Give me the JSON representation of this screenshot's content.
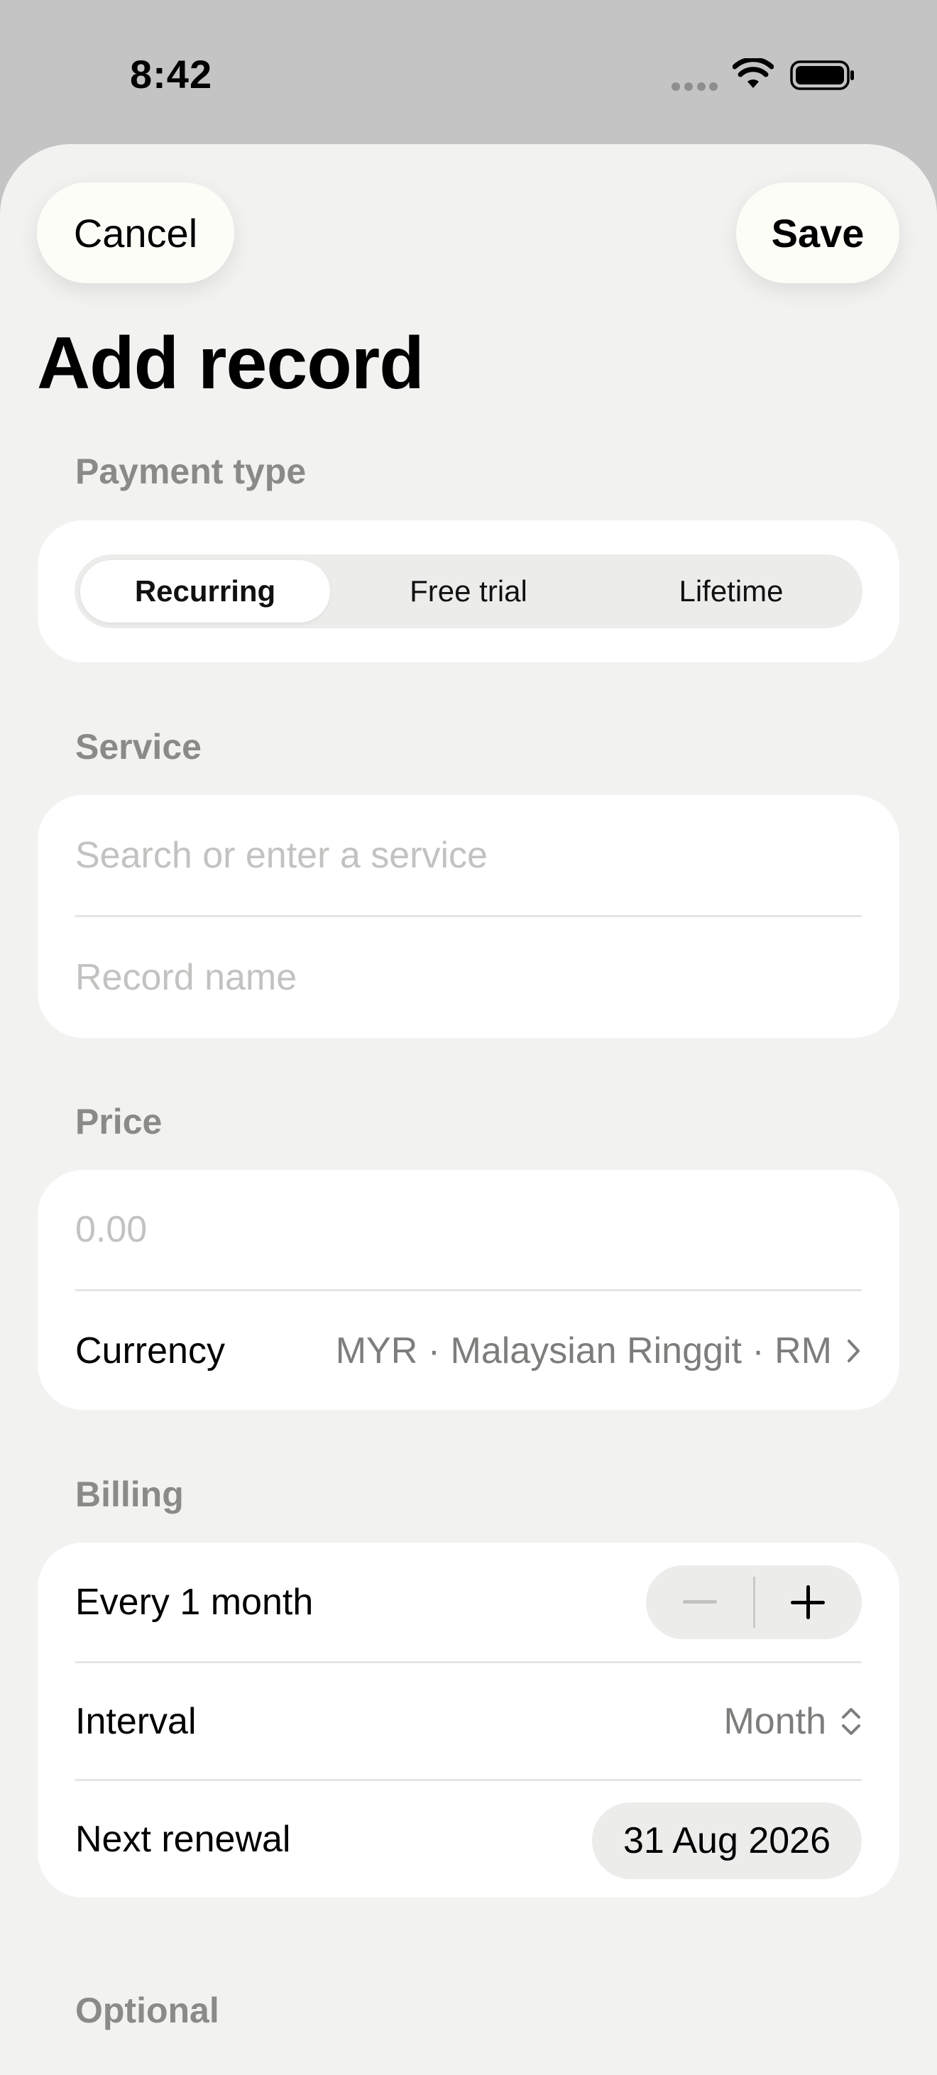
{
  "status": {
    "time": "8:42",
    "icons": [
      "cellular-signal-icon",
      "wifi-icon",
      "battery-icon"
    ]
  },
  "nav": {
    "cancel_label": "Cancel",
    "save_label": "Save"
  },
  "title": "Add record",
  "payment_type": {
    "label": "Payment type",
    "options": [
      "Recurring",
      "Free trial",
      "Lifetime"
    ],
    "selected": "Recurring"
  },
  "service": {
    "label": "Service",
    "service_value": "",
    "service_placeholder": "Search or enter a service",
    "name_value": "",
    "name_placeholder": "Record name"
  },
  "price": {
    "label": "Price",
    "amount_value": "",
    "amount_placeholder": "0.00",
    "currency_label": "Currency",
    "currency_value": "MYR · Malaysian Ringgit · RM"
  },
  "billing": {
    "label": "Billing",
    "every_text": "Every 1 month",
    "interval_label": "Interval",
    "interval_value": "Month",
    "renewal_label": "Next renewal",
    "renewal_value": "31 Aug 2026"
  },
  "optional": {
    "label": "Optional"
  },
  "colors": {
    "sheet_background": "#f2f2f1",
    "backdrop": "#c4c4c4",
    "card": "#ffffff",
    "section_label": "#8a8a88",
    "placeholder": "#c2c2c0",
    "control_fill": "#ececeb"
  }
}
